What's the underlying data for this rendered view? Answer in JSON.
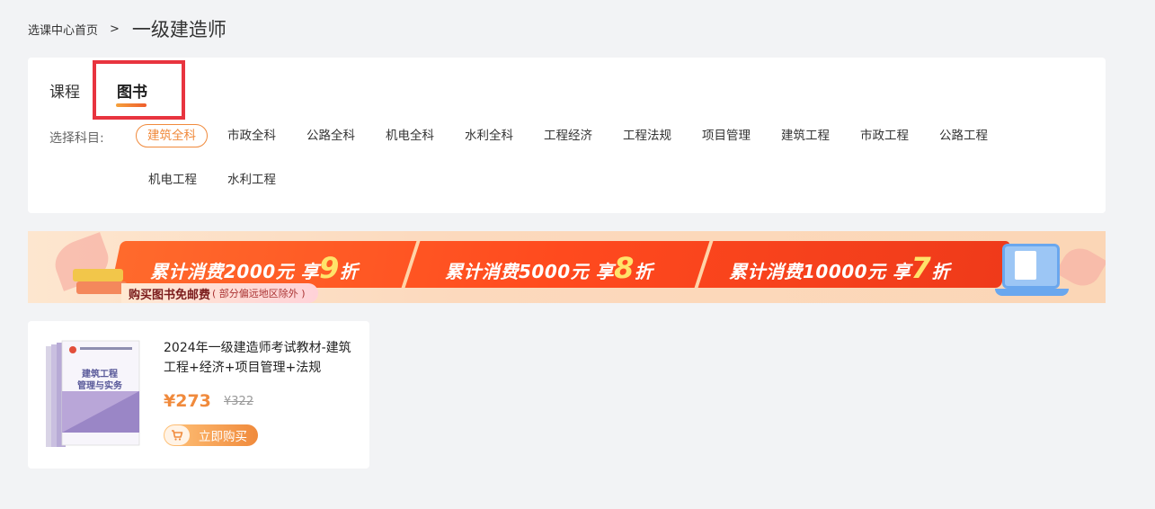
{
  "breadcrumb": {
    "home": "选课中心首页",
    "separator": ">",
    "current": "一级建造师"
  },
  "tabs": [
    {
      "label": "课程",
      "active": false
    },
    {
      "label": "图书",
      "active": true
    }
  ],
  "subject_filter": {
    "label": "选择科目:",
    "options": [
      "建筑全科",
      "市政全科",
      "公路全科",
      "机电全科",
      "水利全科",
      "工程经济",
      "工程法规",
      "项目管理",
      "建筑工程",
      "市政工程",
      "公路工程",
      "机电工程",
      "水利工程"
    ],
    "selected": "建筑全科"
  },
  "banner": {
    "promos": [
      {
        "prefix": "累计消费2000元 享",
        "discount": "9",
        "suffix": "折"
      },
      {
        "prefix": "累计消费5000元 享",
        "discount": "8",
        "suffix": "折"
      },
      {
        "prefix": "累计消费10000元 享",
        "discount": "7",
        "suffix": "折"
      }
    ],
    "free_shipping": "购买图书免邮费",
    "free_shipping_note": "( 部分偏远地区除外 )"
  },
  "products": [
    {
      "title": "2024年一级建造师考试教材-建筑工程+经济+项目管理+法规",
      "price": "¥273",
      "original_price": "¥322",
      "buy_label": "立即购买",
      "cover_title": "建筑工程\n管理与实务"
    }
  ],
  "colors": {
    "accent": "#f08a3c",
    "annotation_red": "#e8343f",
    "background": "#f2f3f5"
  }
}
